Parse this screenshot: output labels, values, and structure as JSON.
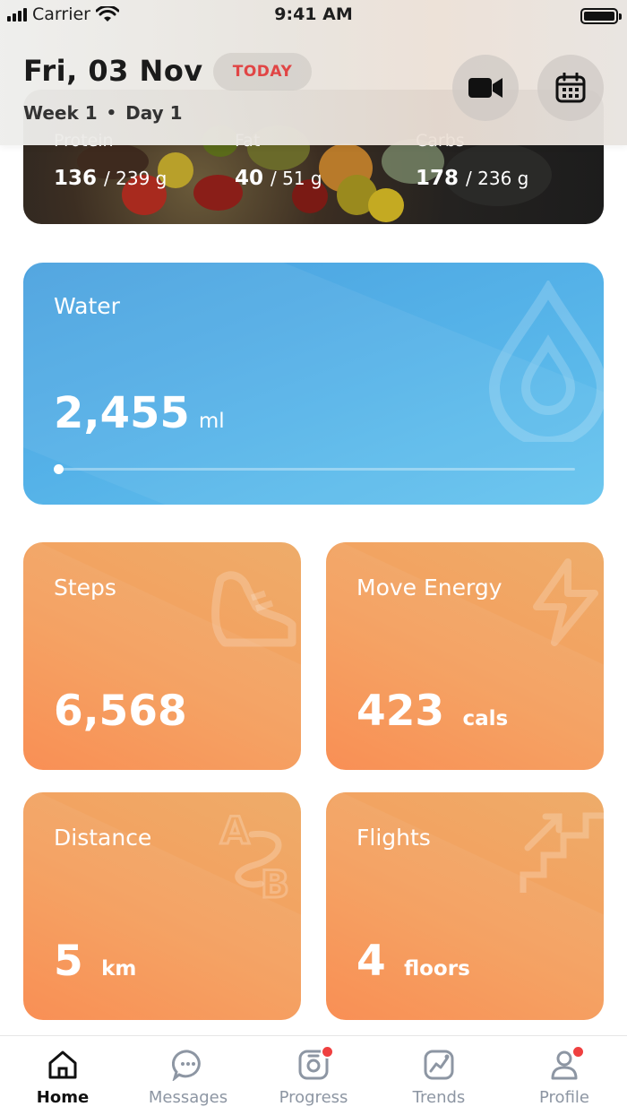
{
  "status_bar": {
    "carrier": "Carrier",
    "time": "9:41 AM"
  },
  "header": {
    "date": "Fri, 03 Nov",
    "today_label": "TODAY",
    "week": "Week 1",
    "separator": "•",
    "day": "Day 1",
    "video_icon": "video-camera-icon",
    "calendar_icon": "calendar-icon"
  },
  "macros": [
    {
      "label": "Protein",
      "current": "136",
      "goal": "/ 239 g"
    },
    {
      "label": "Fat",
      "current": "40",
      "goal": "/ 51 g"
    },
    {
      "label": "Carbs",
      "current": "178",
      "goal": "/ 236 g"
    }
  ],
  "water": {
    "title": "Water",
    "amount": "2,455",
    "unit": "ml",
    "progress": 0.0,
    "icon": "water-drop-icon"
  },
  "stats": {
    "steps": {
      "title": "Steps",
      "value": "6,568",
      "unit": "",
      "icon": "sneaker-icon"
    },
    "energy": {
      "title": "Move Energy",
      "value": "423",
      "unit": "cals",
      "icon": "lightning-icon"
    },
    "distance": {
      "title": "Distance",
      "value": "5",
      "unit": "km",
      "icon": "a-to-b-route-icon"
    },
    "flights": {
      "title": "Flights",
      "value": "4",
      "unit": "floors",
      "icon": "stairs-icon"
    }
  },
  "tabs": [
    {
      "label": "Home",
      "icon": "home-icon",
      "active": true,
      "badge": false
    },
    {
      "label": "Messages",
      "icon": "chat-bubble-icon",
      "active": false,
      "badge": false
    },
    {
      "label": "Progress",
      "icon": "camera-icon",
      "active": false,
      "badge": true
    },
    {
      "label": "Trends",
      "icon": "trend-chart-icon",
      "active": false,
      "badge": false
    },
    {
      "label": "Profile",
      "icon": "user-icon",
      "active": false,
      "badge": true
    }
  ],
  "colors": {
    "today": "#e14545",
    "water_card": "#55b2e8",
    "stat_card": "#f4a05e",
    "badge": "#ef4040"
  }
}
